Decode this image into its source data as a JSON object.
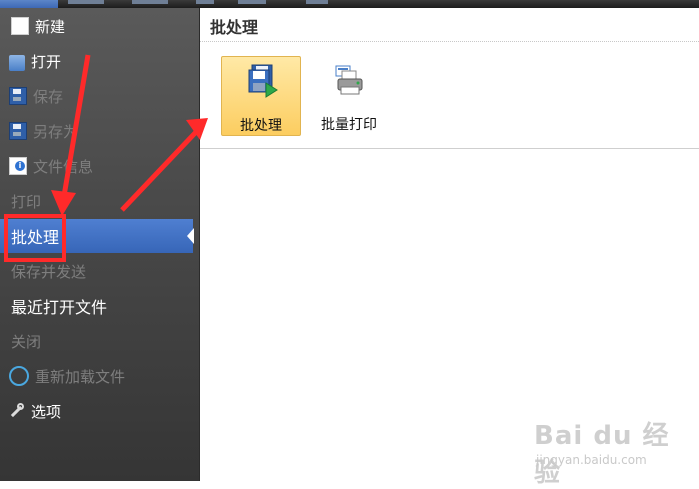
{
  "backstage_menu": {
    "items": [
      {
        "label": "新建",
        "icon": "new-document-icon",
        "state": "enabled"
      },
      {
        "label": "打开",
        "icon": "open-folder-icon",
        "state": "enabled"
      },
      {
        "label": "保存",
        "icon": "save-icon",
        "state": "disabled"
      },
      {
        "label": "另存为",
        "icon": "save-as-icon",
        "state": "disabled"
      },
      {
        "label": "文件信息",
        "icon": "file-info-icon",
        "state": "disabled"
      },
      {
        "label": "打印",
        "icon": "",
        "state": "disabled"
      },
      {
        "label": "批处理",
        "icon": "",
        "state": "selected"
      },
      {
        "label": "保存并发送",
        "icon": "",
        "state": "disabled"
      },
      {
        "label": "最近打开文件",
        "icon": "",
        "state": "enabled"
      },
      {
        "label": "关闭",
        "icon": "",
        "state": "disabled"
      },
      {
        "label": "重新加载文件",
        "icon": "reload-icon",
        "state": "disabled"
      },
      {
        "label": "选项",
        "icon": "wrench-icon",
        "state": "enabled"
      }
    ]
  },
  "main": {
    "title": "批处理",
    "commands": [
      {
        "label": "批处理",
        "icon": "batch-process-icon",
        "active": true
      },
      {
        "label": "批量打印",
        "icon": "batch-print-icon",
        "active": false
      }
    ]
  },
  "watermark": {
    "main": "Bai du 经验",
    "sub": "jingyan.baidu.com"
  },
  "colors": {
    "selected_item": "#4f7fd1",
    "annotation_red": "#ff2a2a",
    "active_command": "#fccd60"
  }
}
